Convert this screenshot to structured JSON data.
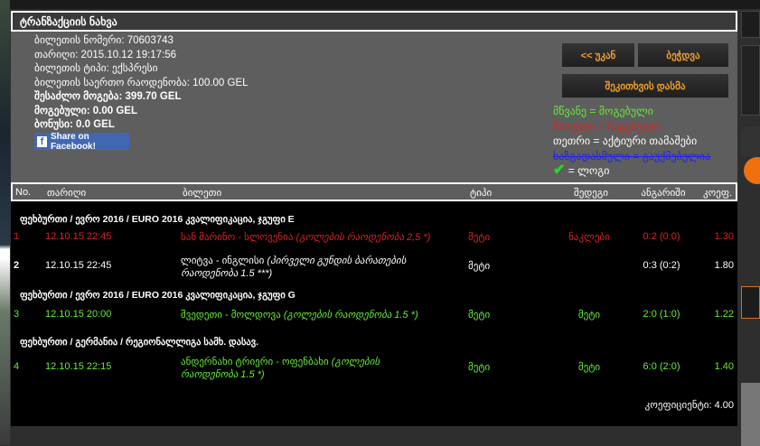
{
  "title": "ტრანზაქციის ნახვა",
  "info": [
    {
      "label": "ბილეთის ნომერი:",
      "value": "70603743"
    },
    {
      "label": "თარიღი:",
      "value": "2015.10.12 19:17:56"
    },
    {
      "label": "ბილეთის ტიპი:",
      "value": "ექსპრესი"
    },
    {
      "label": "ბილეთის საერთო რაოდენობა:",
      "value": "100.00 GEL"
    },
    {
      "label": "შესაძლო მოგება:",
      "value": "399.70 GEL"
    },
    {
      "label": "მოგებული:",
      "value": "0.00 GEL"
    },
    {
      "label": "ბონუსი:",
      "value": "0.0 GEL"
    }
  ],
  "facebook_label": "Share on Facebook!",
  "buttons": {
    "back": "<< უკან",
    "print": "ბეჭდვა",
    "ask": "შეკითხვის დასმა"
  },
  "legend": {
    "green": "მწვანე = მოგებული",
    "red": "წითელი = წაგებული",
    "white": "თეთრი = აქტიური თამაშები",
    "struck": "ხაზგადასმული = გაუქმებულია",
    "check": "= ლოგი"
  },
  "colors": {
    "won": "#66ee33",
    "lost": "#e02020",
    "active": "#ffffff",
    "cancelled": "#2222ee",
    "accent": "#f0a030"
  },
  "headers": [
    "No.",
    "თარიღი",
    "ბილეთი",
    "ტიპი",
    "შედეგი",
    "ანგარიში",
    "კოეფ."
  ],
  "groups": [
    "ფეხბურთი / ევრო 2016 / EURO 2016 კვალიფიკაცია, ჯგუფი E",
    "ფეხბურთი / ევრო 2016 / EURO 2016 კვალიფიკაცია, ჯგუფი G",
    "ფეხბურთი / გერმანია / რეგიონალლიგა სამხ. დასავ."
  ],
  "rows": [
    {
      "no": "1",
      "date": "12.10.15 22:45",
      "match": "სან მარინო - სლოვენია",
      "market": "(გოლების რაოდენობა 2,5 *)",
      "type": "მეტი",
      "result": "ნაკლები",
      "score": "0:2 (0:0)",
      "odds": "1.30",
      "status": "lost"
    },
    {
      "no": "2",
      "date": "12.10.15 22:45",
      "match": "ლიტვა - ინგლისი",
      "market": "(პირველი გუნდის ბარათების რაოდენობა 1.5 ***)",
      "type": "მეტი",
      "result": "",
      "score": "0:3 (0:2)",
      "odds": "1.80",
      "status": "active"
    },
    {
      "no": "3",
      "date": "12.10.15 20:00",
      "match": "შვედეთი - მოლდოვა",
      "market": "(გოლების რაოდენობა 1.5 *)",
      "type": "მეტი",
      "result": "მეტი",
      "score": "2:0 (1:0)",
      "odds": "1.22",
      "status": "won"
    },
    {
      "no": "4",
      "date": "12.10.15 22:15",
      "match": "ანდერნახი ტრიერი - ოფენბახი",
      "market": "(გოლების რაოდენობა 1.5 *)",
      "type": "მეტი",
      "result": "მეტი",
      "score": "6:0 (2:0)",
      "odds": "1.40",
      "status": "won"
    }
  ],
  "total": "კოეფიციენტი: 4.00"
}
